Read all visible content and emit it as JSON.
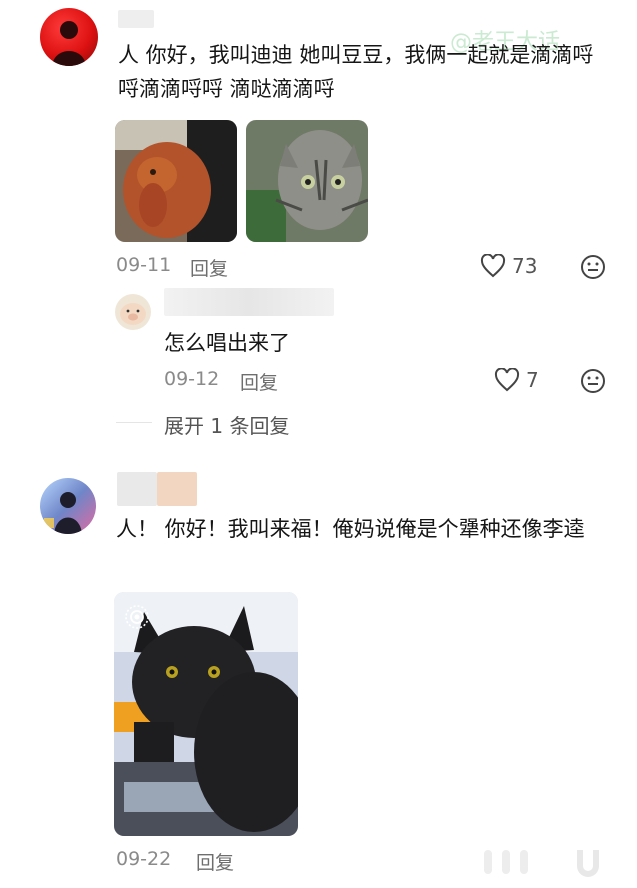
{
  "watermark": "@老王大话",
  "comments": [
    {
      "text": "人 你好，我叫迪迪 她叫豆豆，我俩一起就是滴滴哷哷滴滴哷哷 滴哒滴滴哷",
      "date": "09-11",
      "reply_label": "回复",
      "likes": "73",
      "images": [
        "dog-photo",
        "cat-photo"
      ]
    },
    {
      "text": "人！ 你好！我叫来福！俺妈说俺是个犟种还像李逵",
      "date": "09-22",
      "reply_label": "回复",
      "images": [
        "black-cat-photo"
      ]
    }
  ],
  "sub_reply": {
    "text": "怎么唱出来了",
    "date": "09-12",
    "reply_label": "回复",
    "likes": "7"
  },
  "expand_label": "展开 1 条回复",
  "icons": {
    "like": "heart-outline-icon",
    "dislike": "meh-face-icon",
    "live_photo": "live-photo-icon"
  }
}
